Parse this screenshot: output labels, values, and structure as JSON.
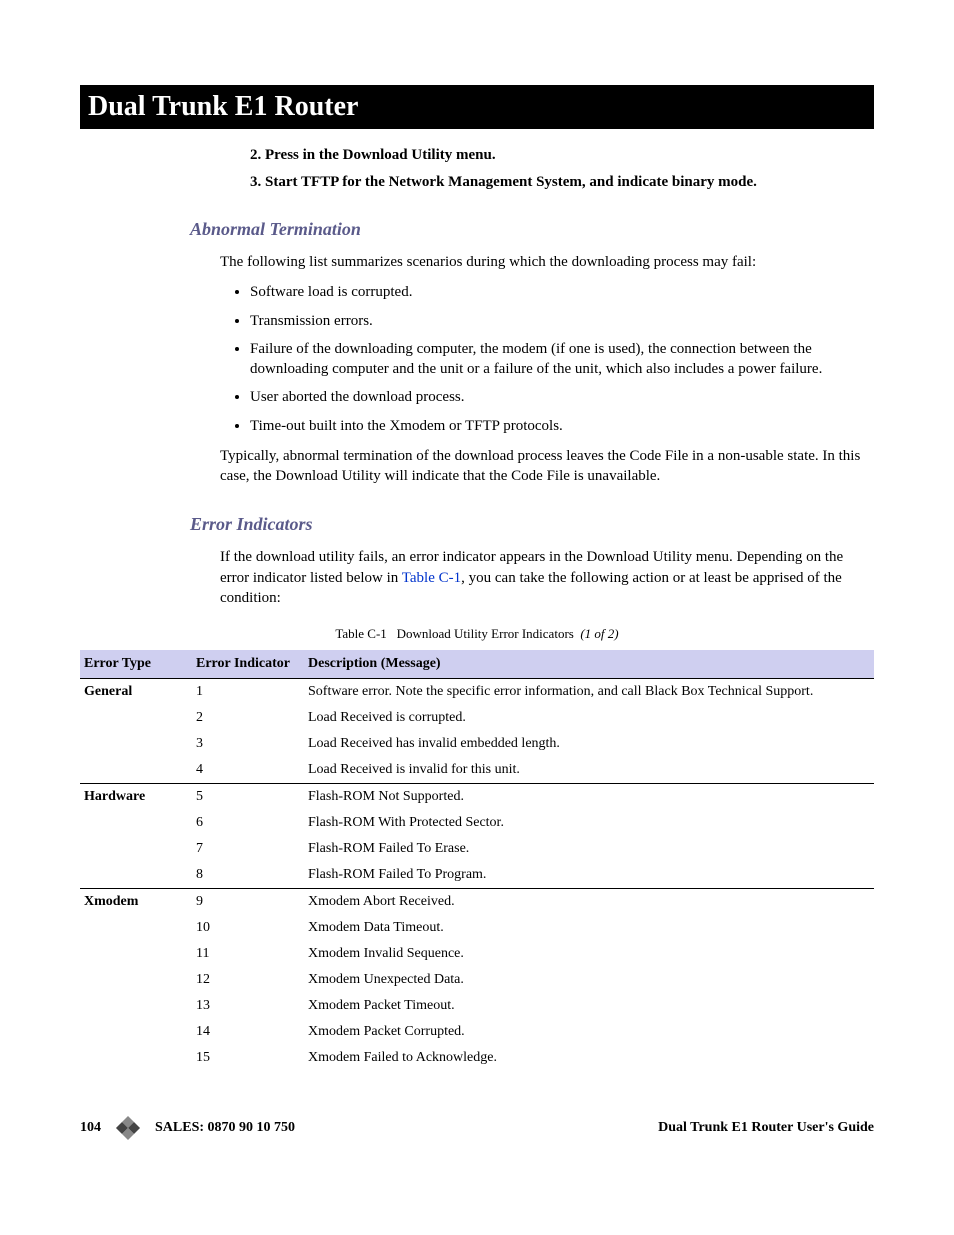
{
  "title": "Dual Trunk E1 Router",
  "steps": [
    "2.  Press      in the Download Utility menu.",
    "3.  Start TFTP for the Network Management System, and indicate binary mode."
  ],
  "abnormal": {
    "heading": "Abnormal Termination",
    "intro": "The following list summarizes scenarios during which the downloading process may fail:",
    "bullets": [
      "Software load is corrupted.",
      "Transmission errors.",
      "Failure of the downloading computer, the modem (if one is used), the connection between the downloading computer and the unit or a failure of the unit, which also includes a power failure.",
      "User aborted the download process.",
      "Time-out built into the Xmodem or TFTP protocols."
    ],
    "after": "Typically, abnormal termination of the download process leaves the Code File in a non-usable state. In this case, the Download Utility will indicate that the Code File is unavailable."
  },
  "error": {
    "heading": "Error Indicators",
    "intro_pre": "If the download utility fails, an error indicator appears in the Download Utility menu. Depending on the error indicator listed below in ",
    "intro_link": "Table C-1",
    "intro_post": ", you can take the following action or at least be apprised of the condition:"
  },
  "table": {
    "caption_label": "Table C-1",
    "caption_title": "Download Utility Error Indicators",
    "caption_page": "(1 of 2)",
    "headers": {
      "type": "Error Type",
      "indicator": "Error Indicator",
      "desc": "Description (Message)"
    },
    "groups": [
      {
        "type": "General",
        "rows": [
          {
            "ind": "1",
            "desc": "Software error. Note the specific error information, and call Black Box Technical Support."
          },
          {
            "ind": "2",
            "desc": "Load Received is corrupted."
          },
          {
            "ind": "3",
            "desc": "Load Received has invalid embedded length."
          },
          {
            "ind": "4",
            "desc": "Load Received is invalid for this unit."
          }
        ]
      },
      {
        "type": "Hardware",
        "rows": [
          {
            "ind": "5",
            "desc": "Flash-ROM Not Supported."
          },
          {
            "ind": "6",
            "desc": "Flash-ROM With Protected Sector."
          },
          {
            "ind": "7",
            "desc": "Flash-ROM Failed To Erase."
          },
          {
            "ind": "8",
            "desc": "Flash-ROM Failed To Program."
          }
        ]
      },
      {
        "type": "Xmodem",
        "rows": [
          {
            "ind": "9",
            "desc": "Xmodem Abort Received."
          },
          {
            "ind": "10",
            "desc": "Xmodem Data Timeout."
          },
          {
            "ind": "11",
            "desc": "Xmodem Invalid Sequence."
          },
          {
            "ind": "12",
            "desc": "Xmodem Unexpected Data."
          },
          {
            "ind": "13",
            "desc": "Xmodem Packet Timeout."
          },
          {
            "ind": "14",
            "desc": "Xmodem Packet Corrupted."
          },
          {
            "ind": "15",
            "desc": "Xmodem Failed to Acknowledge."
          }
        ]
      }
    ]
  },
  "footer": {
    "page": "104",
    "sales": "SALES: 0870 90 10 750",
    "guide": "Dual Trunk E1 Router User's Guide"
  },
  "chart_data": {
    "type": "table",
    "title": "Table C-1 Download Utility Error Indicators (1 of 2)",
    "columns": [
      "Error Type",
      "Error Indicator",
      "Description (Message)"
    ],
    "rows": [
      [
        "General",
        1,
        "Software error. Note the specific error information, and call Black Box Technical Support."
      ],
      [
        "General",
        2,
        "Load Received is corrupted."
      ],
      [
        "General",
        3,
        "Load Received has invalid embedded length."
      ],
      [
        "General",
        4,
        "Load Received is invalid for this unit."
      ],
      [
        "Hardware",
        5,
        "Flash-ROM Not Supported."
      ],
      [
        "Hardware",
        6,
        "Flash-ROM With Protected Sector."
      ],
      [
        "Hardware",
        7,
        "Flash-ROM Failed To Erase."
      ],
      [
        "Hardware",
        8,
        "Flash-ROM Failed To Program."
      ],
      [
        "Xmodem",
        9,
        "Xmodem Abort Received."
      ],
      [
        "Xmodem",
        10,
        "Xmodem Data Timeout."
      ],
      [
        "Xmodem",
        11,
        "Xmodem Invalid Sequence."
      ],
      [
        "Xmodem",
        12,
        "Xmodem Unexpected Data."
      ],
      [
        "Xmodem",
        13,
        "Xmodem Packet Timeout."
      ],
      [
        "Xmodem",
        14,
        "Xmodem Packet Corrupted."
      ],
      [
        "Xmodem",
        15,
        "Xmodem Failed to Acknowledge."
      ]
    ]
  }
}
